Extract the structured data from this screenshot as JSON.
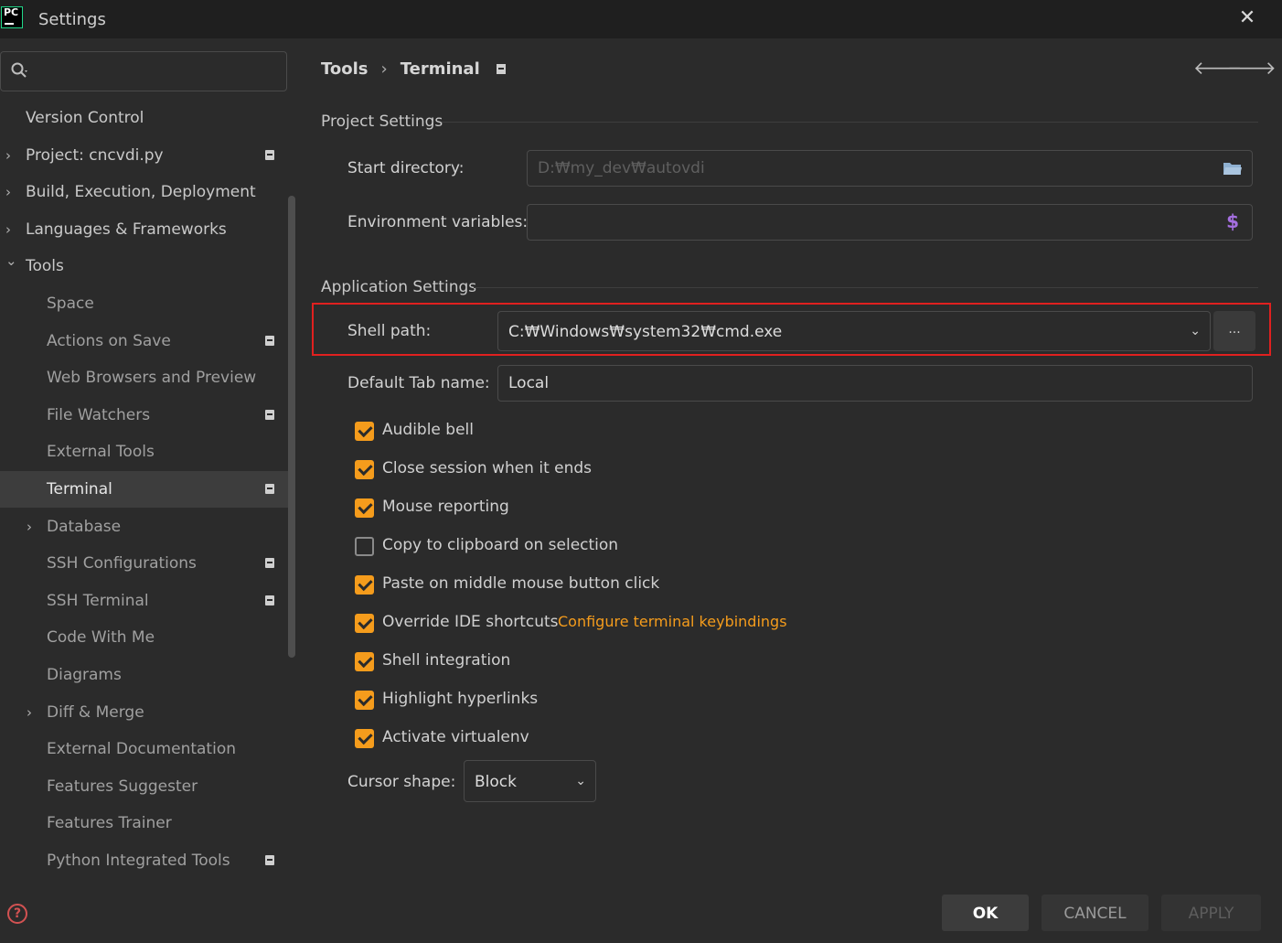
{
  "window": {
    "title": "Settings",
    "app_logo": "PC"
  },
  "search": {
    "placeholder": ""
  },
  "sidebar": {
    "items": [
      {
        "label": "Version Control",
        "level": 0,
        "arrow": "",
        "badge": false
      },
      {
        "label": "Project: cncvdi.py",
        "level": 0,
        "arrow": "right",
        "badge": true
      },
      {
        "label": "Build, Execution, Deployment",
        "level": 0,
        "arrow": "right",
        "badge": false
      },
      {
        "label": "Languages & Frameworks",
        "level": 0,
        "arrow": "right",
        "badge": false
      },
      {
        "label": "Tools",
        "level": 0,
        "arrow": "down",
        "badge": false
      },
      {
        "label": "Space",
        "level": 1,
        "arrow": "",
        "badge": false
      },
      {
        "label": "Actions on Save",
        "level": 1,
        "arrow": "",
        "badge": true
      },
      {
        "label": "Web Browsers and Preview",
        "level": 1,
        "arrow": "",
        "badge": false
      },
      {
        "label": "File Watchers",
        "level": 1,
        "arrow": "",
        "badge": true
      },
      {
        "label": "External Tools",
        "level": 1,
        "arrow": "",
        "badge": false
      },
      {
        "label": "Terminal",
        "level": 1,
        "arrow": "",
        "badge": true,
        "selected": true
      },
      {
        "label": "Database",
        "level": 1,
        "arrow": "right",
        "badge": false
      },
      {
        "label": "SSH Configurations",
        "level": 1,
        "arrow": "",
        "badge": true
      },
      {
        "label": "SSH Terminal",
        "level": 1,
        "arrow": "",
        "badge": true
      },
      {
        "label": "Code With Me",
        "level": 1,
        "arrow": "",
        "badge": false
      },
      {
        "label": "Diagrams",
        "level": 1,
        "arrow": "",
        "badge": false
      },
      {
        "label": "Diff & Merge",
        "level": 1,
        "arrow": "right",
        "badge": false
      },
      {
        "label": "External Documentation",
        "level": 1,
        "arrow": "",
        "badge": false
      },
      {
        "label": "Features Suggester",
        "level": 1,
        "arrow": "",
        "badge": false
      },
      {
        "label": "Features Trainer",
        "level": 1,
        "arrow": "",
        "badge": false
      },
      {
        "label": "Python Integrated Tools",
        "level": 1,
        "arrow": "",
        "badge": true
      }
    ]
  },
  "breadcrumb": {
    "parent": "Tools",
    "separator": "›",
    "current": "Terminal"
  },
  "project_settings": {
    "title": "Project Settings",
    "start_directory": {
      "label": "Start directory:",
      "value": "D:₩my_dev₩autovdi"
    },
    "environment_variables": {
      "label": "Environment variables:",
      "value": ""
    }
  },
  "application_settings": {
    "title": "Application Settings",
    "shell_path": {
      "label": "Shell path:",
      "value": "C:₩Windows₩system32₩cmd.exe",
      "browse_label": "..."
    },
    "default_tab_name": {
      "label": "Default Tab name:",
      "value": "Local"
    },
    "checkboxes": [
      {
        "label": "Audible bell",
        "checked": true
      },
      {
        "label": "Close session when it ends",
        "checked": true
      },
      {
        "label": "Mouse reporting",
        "checked": true
      },
      {
        "label": "Copy to clipboard on selection",
        "checked": false
      },
      {
        "label": "Paste on middle mouse button click",
        "checked": true
      },
      {
        "label": "Override IDE shortcuts",
        "checked": true
      },
      {
        "label": "Shell integration",
        "checked": true
      },
      {
        "label": "Highlight hyperlinks",
        "checked": true
      },
      {
        "label": "Activate virtualenv",
        "checked": true
      }
    ],
    "keybindings_link": "Configure terminal keybindings",
    "cursor_shape": {
      "label": "Cursor shape:",
      "value": "Block"
    }
  },
  "buttons": {
    "ok": "OK",
    "cancel": "CANCEL",
    "apply": "APPLY"
  },
  "colors": {
    "accent": "#f59c1c",
    "highlight_border": "#e0201f",
    "dollar": "#a56fe0"
  }
}
